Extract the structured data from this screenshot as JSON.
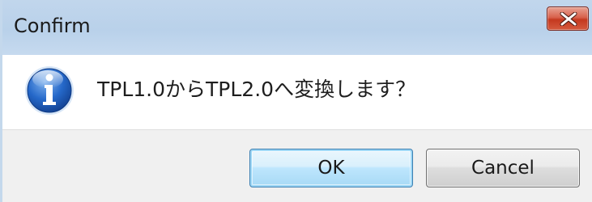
{
  "window": {
    "title": "Confirm"
  },
  "message": {
    "text": "TPL1.0からTPL2.0へ変換します？",
    "icon": "info-icon"
  },
  "buttons": {
    "ok_label": "OK",
    "cancel_label": "Cancel"
  },
  "colors": {
    "titlebar": "#b9d1ea",
    "close_button": "#c4391f",
    "footer": "#f0f0f0",
    "ok_border": "#3c7fb1",
    "icon_blue": "#1f5fb8"
  }
}
